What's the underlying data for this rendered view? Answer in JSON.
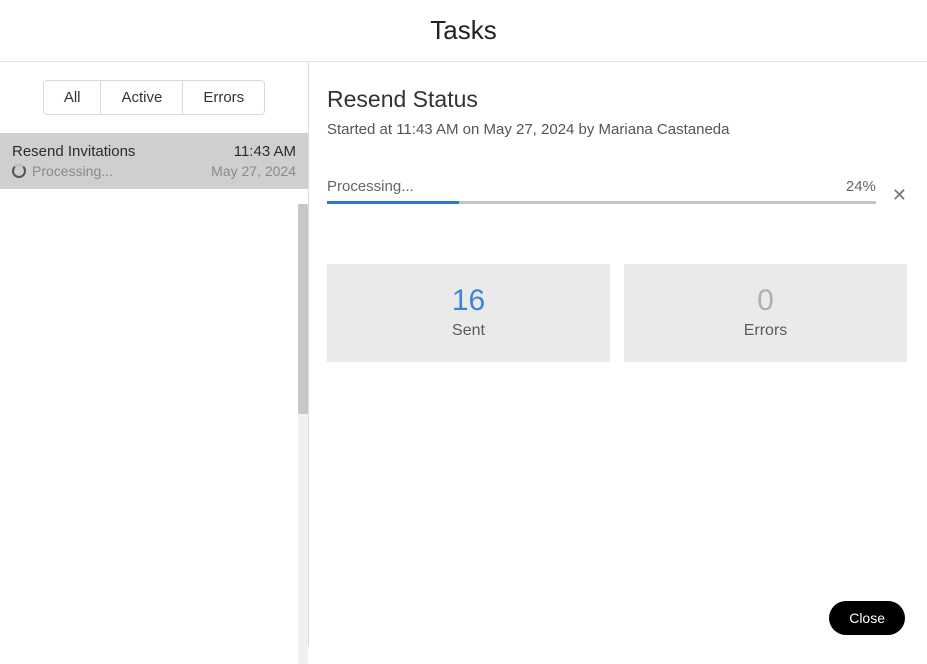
{
  "header": {
    "title": "Tasks"
  },
  "sidebar": {
    "filters": {
      "all": "All",
      "active": "Active",
      "errors": "Errors"
    },
    "task": {
      "name": "Resend Invitations",
      "time": "11:43 AM",
      "status": "Processing...",
      "date": "May 27, 2024"
    }
  },
  "detail": {
    "title": "Resend Status",
    "subtitle": "Started at 11:43 AM on May 27, 2024 by Mariana Castaneda",
    "progress": {
      "label": "Processing...",
      "percent_text": "24%",
      "percent_value": 24
    },
    "stats": {
      "sent_value": "16",
      "sent_label": "Sent",
      "errors_value": "0",
      "errors_label": "Errors"
    }
  },
  "footer": {
    "close": "Close"
  }
}
